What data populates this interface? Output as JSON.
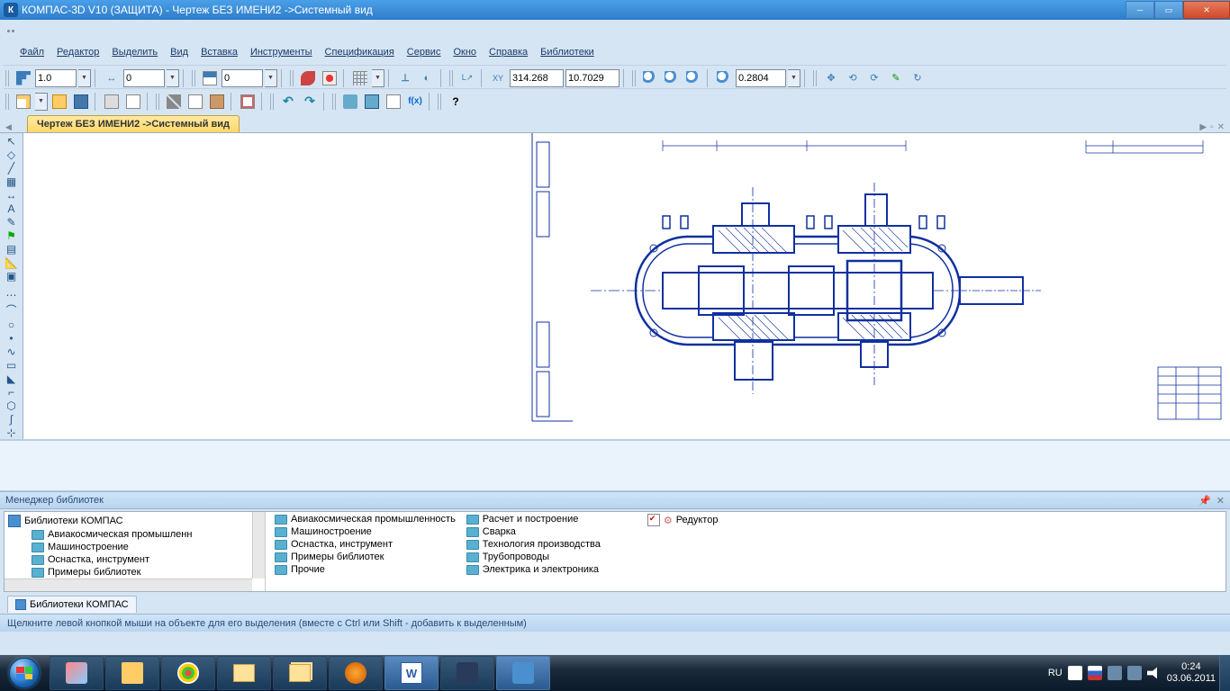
{
  "window": {
    "title": "КОМПАС-3D V10 (ЗАЩИТА) - Чертеж БЕЗ ИМЕНИ2 ->Системный вид",
    "app_badge": "К"
  },
  "menu": {
    "file": "Файл",
    "editor": "Редактор",
    "select": "Выделить",
    "view": "Вид",
    "insert": "Вставка",
    "tools": "Инструменты",
    "spec": "Спецификация",
    "service": "Сервис",
    "window": "Окно",
    "help": "Справка",
    "libraries": "Библиотеки"
  },
  "toolbar1": {
    "step_value": "1.0",
    "angle_value": "0",
    "style_value": "0",
    "coord_x": "314.268",
    "coord_y": "10.7029",
    "zoom_value": "0.2804"
  },
  "doc_tab": {
    "label": "Чертеж БЕЗ ИМЕНИ2 ->Системный вид"
  },
  "libmgr": {
    "title": "Менеджер библиотек",
    "root": "Библиотеки КОМПАС",
    "tree": [
      "Авиакосмическая промышленн",
      "Машиностроение",
      "Оснастка, инструмент",
      "Примеры библиотек"
    ],
    "col1": [
      "Авиакосмическая промышленность",
      "Машиностроение",
      "Оснастка, инструмент",
      "Примеры библиотек",
      "Прочие"
    ],
    "col2": [
      "Расчет и построение",
      "Сварка",
      "Технология производства",
      "Трубопроводы",
      "Электрика и электроника"
    ],
    "checked_item": "Редуктор",
    "tab_label": "Библиотеки КОМПАС"
  },
  "status": {
    "text": "Щелкните левой кнопкой мыши на объекте для его выделения (вместе с Ctrl или Shift - добавить к выделенным)"
  },
  "tray": {
    "lang": "RU",
    "time": "0:24",
    "date": "03.06.2011"
  }
}
